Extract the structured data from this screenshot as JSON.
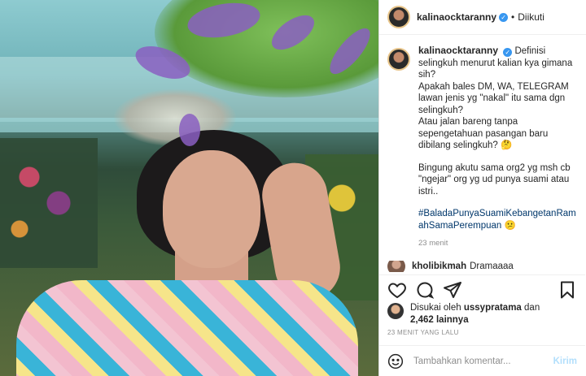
{
  "post": {
    "username": "kalinaocktaranny",
    "dot": "•",
    "follow_status": "Diikuti",
    "caption_lines": [
      "Definisi selingkuh menurut kalian kya gimana sih?",
      "Apakah bales DM, WA, TELEGRAM lawan jenis yg \"nakal\" itu sama dgn selingkuh?",
      "Atau jalan bareng tanpa sepengetahuan pasangan baru dibilang selingkuh? 🤔"
    ],
    "caption_para2": "Bingung akutu sama org2 yg msh cb \"ngejar\" org yg ud punya suami atau istri..",
    "hashtag": "#BaladaPunyaSuamiKebangetanRamahSamaPerempuan",
    "hashtag_emoji": "😕",
    "relative_time": "23 menit",
    "partial_comment_user": "kholibikmah",
    "partial_comment_text": "Dramaaaa",
    "liked_by_prefix": "Disukai oleh",
    "liked_by_user": "ussypratama",
    "liked_by_and": "dan",
    "liked_by_count": "2,462 lainnya",
    "date": "23 MENIT YANG LALU",
    "comment_placeholder": "Tambahkan komentar...",
    "send_label": "Kirim"
  },
  "icons": {
    "verified": "verified-badge-icon",
    "like": "heart-icon",
    "comment": "comment-icon",
    "share": "paper-plane-icon",
    "save": "bookmark-icon",
    "emoji": "smiley-icon"
  },
  "colors": {
    "verified": "#3897f0",
    "hashtag": "#00376b",
    "muted": "#8e8e8e",
    "send_disabled": "#b2dffc"
  }
}
